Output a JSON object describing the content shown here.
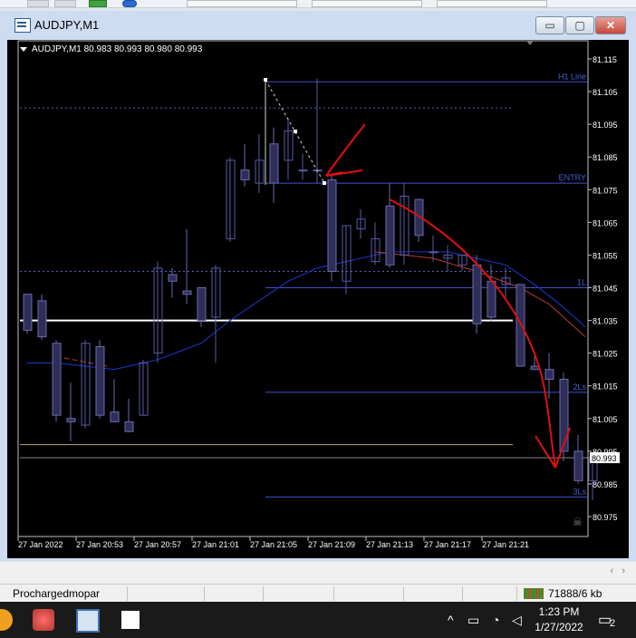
{
  "window": {
    "title": "AUDJPY,M1",
    "controls": {
      "minimize": "▭",
      "maximize": "▢",
      "close": "✕"
    }
  },
  "chart_header": {
    "text": "AUDJPY,M1  80.983 80.993 80.980 80.993"
  },
  "chart_data": {
    "type": "candlestick",
    "price_scale": {
      "min": 80.975,
      "max": 81.115,
      "step": 0.01
    },
    "ticks": [
      "81.115",
      "81.105",
      "81.095",
      "81.085",
      "81.075",
      "81.065",
      "81.055",
      "81.045",
      "81.035",
      "81.025",
      "81.015",
      "81.005",
      "80.995",
      "80.985",
      "80.975"
    ],
    "time_labels": [
      "27 Jan 2022",
      "27 Jan 20:53",
      "27 Jan 20:57",
      "27 Jan 21:01",
      "27 Jan 21:05",
      "27 Jan 21:09",
      "27 Jan 21:13",
      "27 Jan 21:17",
      "27 Jan 21:21"
    ],
    "current_price_label": "80.993",
    "candles": [
      [
        81.043,
        81.04,
        81.031,
        81.032
      ],
      [
        81.041,
        81.043,
        81.029,
        81.03
      ],
      [
        81.028,
        81.029,
        81.004,
        81.006
      ],
      [
        81.005,
        81.016,
        80.998,
        81.004
      ],
      [
        81.003,
        81.029,
        81.002,
        81.028
      ],
      [
        81.027,
        81.029,
        81.005,
        81.006
      ],
      [
        81.007,
        81.017,
        81.004,
        81.004
      ],
      [
        81.004,
        81.011,
        81.001,
        81.001
      ],
      [
        81.006,
        81.023,
        81.006,
        81.022
      ],
      [
        81.025,
        81.053,
        81.022,
        81.051
      ],
      [
        81.049,
        81.051,
        81.042,
        81.047
      ],
      [
        81.044,
        81.063,
        81.04,
        81.043
      ],
      [
        81.045,
        81.036,
        81.033,
        81.035
      ],
      [
        81.036,
        81.052,
        81.022,
        81.051
      ],
      [
        81.06,
        81.085,
        81.059,
        81.084
      ],
      [
        81.081,
        81.089,
        81.076,
        81.078
      ],
      [
        81.077,
        81.092,
        81.074,
        81.084
      ],
      [
        81.089,
        81.094,
        81.071,
        81.077
      ],
      [
        81.084,
        81.097,
        81.078,
        81.093
      ],
      [
        81.081,
        81.086,
        81.078,
        81.081
      ],
      [
        81.081,
        81.109,
        81.077,
        81.081
      ],
      [
        81.078,
        81.08,
        81.047,
        81.05
      ],
      [
        81.047,
        81.064,
        81.043,
        81.064
      ],
      [
        81.063,
        81.069,
        81.06,
        81.066
      ],
      [
        81.053,
        81.065,
        81.052,
        81.06
      ],
      [
        81.07,
        81.077,
        81.051,
        81.052
      ],
      [
        81.055,
        81.077,
        81.052,
        81.073
      ],
      [
        81.072,
        81.072,
        81.059,
        81.061
      ],
      [
        81.056,
        81.061,
        81.053,
        81.056
      ],
      [
        81.054,
        81.058,
        81.05,
        81.055
      ],
      [
        81.052,
        81.055,
        81.05,
        81.055
      ],
      [
        81.052,
        81.055,
        81.031,
        81.034
      ],
      [
        81.047,
        81.052,
        81.035,
        81.036
      ],
      [
        81.046,
        81.051,
        81.042,
        81.048
      ],
      [
        81.046,
        81.046,
        81.021,
        81.021
      ],
      [
        81.021,
        81.024,
        81.02,
        81.02
      ],
      [
        81.02,
        81.025,
        81.011,
        81.017
      ],
      [
        81.017,
        81.019,
        80.992,
        80.995
      ],
      [
        80.995,
        81.0,
        80.985,
        80.986
      ],
      [
        80.986,
        80.991,
        80.98,
        80.993
      ]
    ],
    "levels": [
      {
        "label": "H1 Line",
        "price": 81.108
      },
      {
        "label": "ENTRY",
        "price": 81.077
      },
      {
        "label": "1L",
        "price": 81.045
      },
      {
        "label": "2Ls",
        "price": 81.013
      },
      {
        "label": "3Ls",
        "price": 80.981
      }
    ],
    "horizontal_lines": [
      {
        "price": 81.1,
        "style": "dotted"
      },
      {
        "price": 81.05,
        "style": "dotted"
      },
      {
        "price": 81.035,
        "style": "solid-white"
      },
      {
        "price": 80.997,
        "style": "solid-tan"
      },
      {
        "price": 80.993,
        "style": "bid"
      }
    ],
    "ma_series": [
      [
        0,
        81.022
      ],
      [
        2,
        81.022
      ],
      [
        6,
        81.02
      ],
      [
        9,
        81.023
      ],
      [
        12,
        81.028
      ],
      [
        14,
        81.035
      ],
      [
        16,
        81.041
      ],
      [
        18,
        81.047
      ],
      [
        20,
        81.051
      ],
      [
        21,
        81.052
      ],
      [
        23,
        81.054
      ],
      [
        25,
        81.056
      ],
      [
        27,
        81.056
      ],
      [
        29,
        81.056
      ],
      [
        31,
        81.054
      ],
      [
        33,
        81.052
      ],
      [
        35,
        81.046
      ],
      [
        37,
        81.039
      ],
      [
        38.5,
        81.033
      ]
    ],
    "colors": {
      "bull_fill": "#ffffff00",
      "bull_stroke": "#5a5aa8",
      "bear_fill": "#2e2e58",
      "bear_stroke": "#6a6ab0",
      "level_line": "#3f52c9",
      "level_text": "#4a5fd6",
      "ma": "#1c2fb0",
      "annotation": "#e01010"
    }
  },
  "status": {
    "account_name": "Prochargedmopar",
    "net": "71888/6 kb"
  },
  "taskbar": {
    "time": "1:23 PM",
    "date": "1/27/2022",
    "notifications": "2",
    "tray_icons": [
      "chevron-up-icon",
      "battery-icon",
      "wifi-icon",
      "volume-icon"
    ]
  }
}
